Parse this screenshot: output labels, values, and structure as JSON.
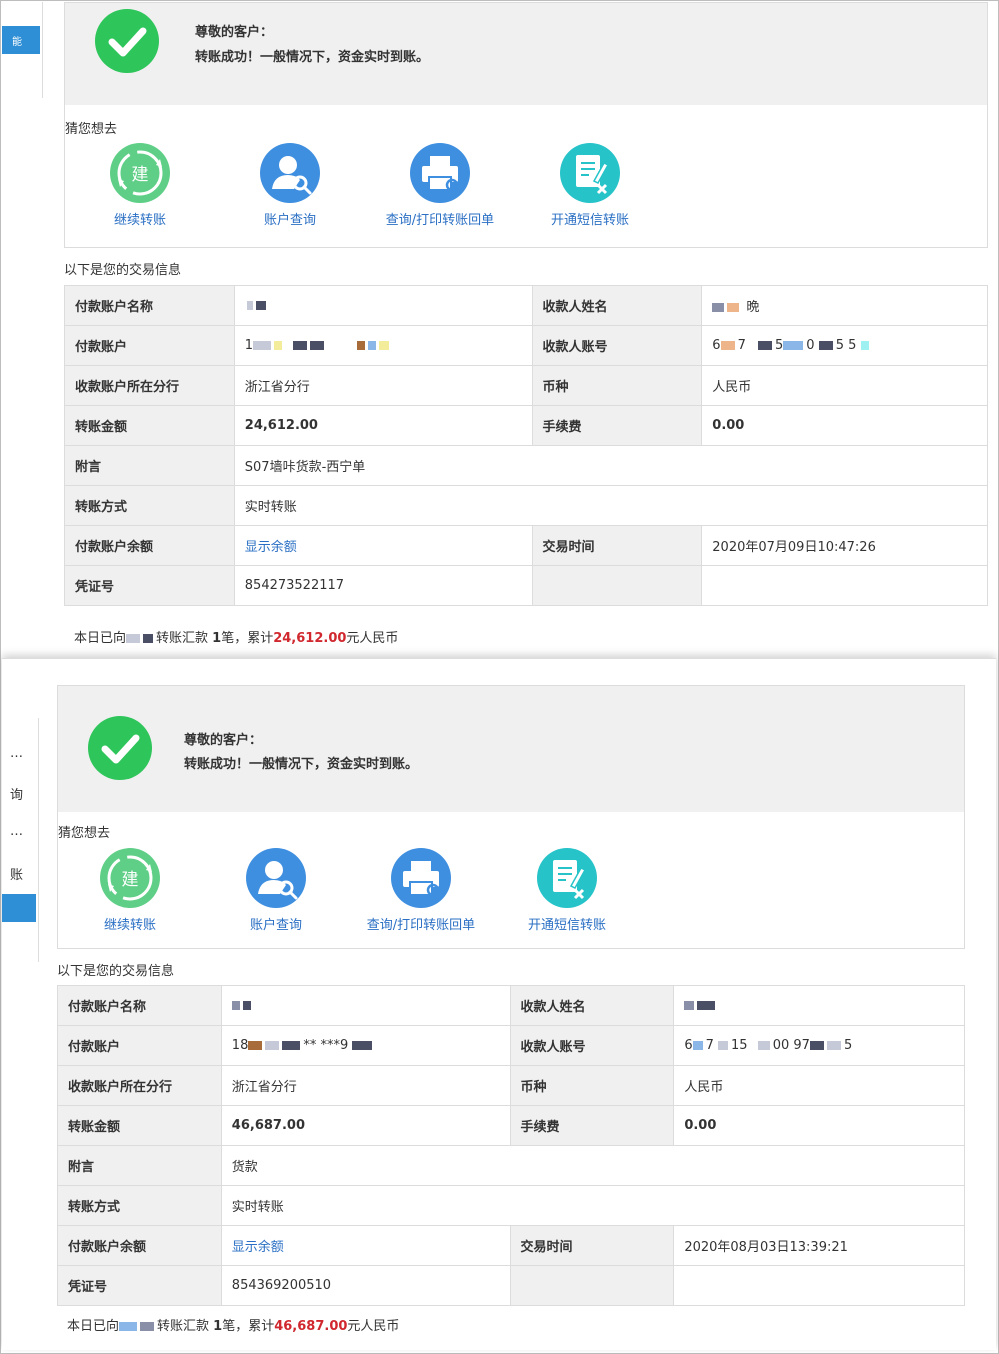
{
  "receipts": [
    {
      "side_nav_fragments": [
        "能"
      ],
      "banner": {
        "greeting": "尊敬的客户：",
        "message": "转账成功！一般情况下，资金实时到账。"
      },
      "guess": {
        "title": "猜您想去",
        "items": [
          {
            "label": "继续转账",
            "icon": "continue-transfer-icon",
            "glyph": "建"
          },
          {
            "label": "账户查询",
            "icon": "account-query-icon"
          },
          {
            "label": "查询/打印转账回单",
            "icon": "printer-icon"
          },
          {
            "label": "开通短信转账",
            "icon": "sms-transfer-icon"
          }
        ]
      },
      "details": {
        "title": "以下是您的交易信息",
        "payer_name_label": "付款账户名称",
        "payee_name_label": "收款人姓名",
        "payee_name_value": "晩",
        "payer_account_label": "付款账户",
        "payer_account_value": "1",
        "payee_account_label": "收款人账号",
        "payee_account_parts": [
          "6",
          "7",
          "5",
          "0",
          "5 5"
        ],
        "branch_label": "收款账户所在分行",
        "branch_value": "浙江省分行",
        "currency_label": "币种",
        "currency_value": "人民币",
        "amount_label": "转账金额",
        "amount_value": "24,612.00",
        "fee_label": "手续费",
        "fee_value": "0.00",
        "memo_label": "附言",
        "memo_value": "S07墙咔货款-西宁单",
        "method_label": "转账方式",
        "method_value": "实时转账",
        "balance_label": "付款账户余额",
        "balance_link": "显示余额",
        "time_label": "交易时间",
        "time_value": "2020年07月09日10:47:26",
        "voucher_label": "凭证号",
        "voucher_value": "854273522117"
      },
      "summary": {
        "prefix": "本日已向",
        "middle": "转账汇款 ",
        "count": "1",
        "count_unit": "笔，累计",
        "amount": "24,612.00",
        "suffix": "元人民币"
      }
    },
    {
      "side_nav_fragments": [
        "…",
        "询",
        "…",
        "账"
      ],
      "banner": {
        "greeting": "尊敬的客户：",
        "message": "转账成功！一般情况下，资金实时到账。"
      },
      "guess": {
        "title": "猜您想去",
        "items": [
          {
            "label": "继续转账",
            "icon": "continue-transfer-icon",
            "glyph": "建"
          },
          {
            "label": "账户查询",
            "icon": "account-query-icon"
          },
          {
            "label": "查询/打印转账回单",
            "icon": "printer-icon"
          },
          {
            "label": "开通短信转账",
            "icon": "sms-transfer-icon"
          }
        ]
      },
      "details": {
        "title": "以下是您的交易信息",
        "payer_name_label": "付款账户名称",
        "payee_name_label": "收款人姓名",
        "payee_name_value": "",
        "payer_account_label": "付款账户",
        "payer_account_value": "18",
        "payer_account_mask": "** ***9",
        "payee_account_label": "收款人账号",
        "payee_account_parts": [
          "6",
          "7",
          "15",
          "00 97",
          "5"
        ],
        "branch_label": "收款账户所在分行",
        "branch_value": "浙江省分行",
        "currency_label": "币种",
        "currency_value": "人民币",
        "amount_label": "转账金额",
        "amount_value": "46,687.00",
        "fee_label": "手续费",
        "fee_value": "0.00",
        "memo_label": "附言",
        "memo_value": "货款",
        "method_label": "转账方式",
        "method_value": "实时转账",
        "balance_label": "付款账户余额",
        "balance_link": "显示余额",
        "time_label": "交易时间",
        "time_value": "2020年08月03日13:39:21",
        "voucher_label": "凭证号",
        "voucher_value": "854369200510"
      },
      "summary": {
        "prefix": "本日已向",
        "middle": "转账汇款 ",
        "count": "1",
        "count_unit": "笔，累计",
        "amount": "46,687.00",
        "suffix": "元人民币"
      }
    }
  ],
  "colors": {
    "success_green": "#2ec55a",
    "icon_green": "#5fcf87",
    "icon_blue": "#3f8fe0",
    "icon_teal": "#26c3c9",
    "link_blue": "#2a6fc4",
    "amount_red": "#d0282e",
    "label_bg": "#f0f0f0",
    "nav_blue": "#2f8fd6"
  }
}
